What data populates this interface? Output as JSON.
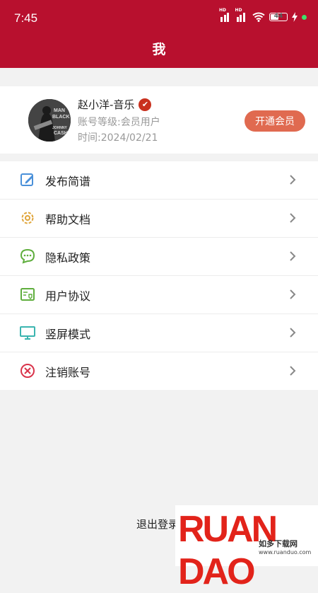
{
  "status_bar": {
    "time": "7:45",
    "battery": "44",
    "hd_label": "HD"
  },
  "header": {
    "title": "我"
  },
  "profile": {
    "name": "赵小洋-音乐",
    "level": "账号等级:会员用户",
    "date": "时间:2024/02/21",
    "vip_button": "开通会员",
    "avatar_text": [
      "MAN",
      "BLACK",
      "JOHNNY",
      "CASH"
    ]
  },
  "menu": {
    "items": [
      {
        "label": "发布简谱",
        "icon": "edit-icon",
        "color": "#4a90d9"
      },
      {
        "label": "帮助文档",
        "icon": "gear-icon",
        "color": "#e0a53a"
      },
      {
        "label": "隐私政策",
        "icon": "chat-icon",
        "color": "#5fae3d"
      },
      {
        "label": "用户协议",
        "icon": "agreement-icon",
        "color": "#5fae3d"
      },
      {
        "label": "竖屏模式",
        "icon": "monitor-icon",
        "color": "#3bb5b0"
      },
      {
        "label": "注销账号",
        "icon": "cancel-circle-icon",
        "color": "#d9334a"
      }
    ]
  },
  "footer": {
    "logout": "退出登录"
  },
  "watermark": {
    "brand": "RUAN DAO",
    "sub": "如多下载网",
    "url": "www.ruanduo.com"
  },
  "colors": {
    "header": "#b8102e",
    "vip": "#e06a50",
    "badge": "#c9311e"
  }
}
